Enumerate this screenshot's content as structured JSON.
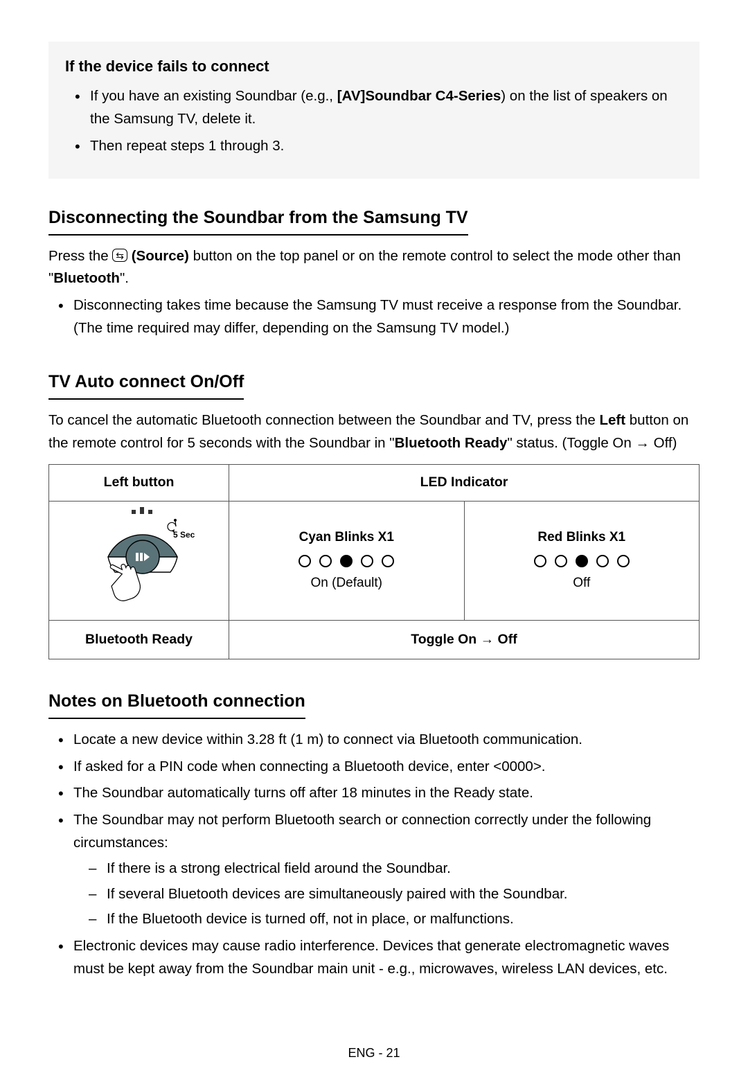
{
  "greyBox": {
    "title": "If the device fails to connect",
    "item1_pre": "If you have an existing Soundbar (e.g., ",
    "item1_bold": "[AV]Soundbar C4-Series",
    "item1_post": ") on the list of speakers on the Samsung TV, delete it.",
    "item2": "Then repeat steps 1 through 3."
  },
  "disconnect": {
    "heading": "Disconnecting the Soundbar from the Samsung TV",
    "p1_pre": "Press the ",
    "p1_source": "(Source)",
    "p1_mid": " button on the top panel or on the remote control to select the mode other than \"",
    "p1_bold2": "Bluetooth",
    "p1_post": "\".",
    "bullet": "Disconnecting takes time because the Samsung TV must receive a response from the Soundbar. (The time required may differ, depending on the Samsung TV model.)"
  },
  "autoConnect": {
    "heading": "TV Auto connect On/Off",
    "p_pre": "To cancel the automatic Bluetooth connection between the Soundbar and TV, press the ",
    "p_bold1": "Left",
    "p_mid": " button on the remote control for 5 seconds with the Soundbar in \"",
    "p_bold2": "Bluetooth Ready",
    "p_post": "\" status. (Toggle On → Off)"
  },
  "table": {
    "header_left": "Left button",
    "header_led": "LED Indicator",
    "fiveSec": "5 Sec",
    "cyan_label": "Cyan Blinks X1",
    "cyan_sub": "On (Default)",
    "red_label": "Red Blinks X1",
    "red_sub": "Off",
    "status_left": "Bluetooth Ready",
    "status_right": "Toggle On → Off"
  },
  "notes": {
    "heading": "Notes on Bluetooth connection",
    "b1": "Locate a new device within 3.28 ft (1 m) to connect via Bluetooth communication.",
    "b2": "If asked for a PIN code when connecting a Bluetooth device, enter <0000>.",
    "b3": "The Soundbar automatically turns off after 18 minutes in the Ready state.",
    "b4": "The Soundbar may not perform Bluetooth search or connection correctly under the following circumstances:",
    "b4_s1": "If there is a strong electrical field around the Soundbar.",
    "b4_s2": "If several Bluetooth devices are simultaneously paired with the Soundbar.",
    "b4_s3": "If the Bluetooth device is turned off, not in place, or malfunctions.",
    "b5": "Electronic devices may cause radio interference. Devices that generate electromagnetic waves must be kept away from the Soundbar main unit - e.g., microwaves, wireless LAN devices, etc."
  },
  "footer": "ENG - 21"
}
